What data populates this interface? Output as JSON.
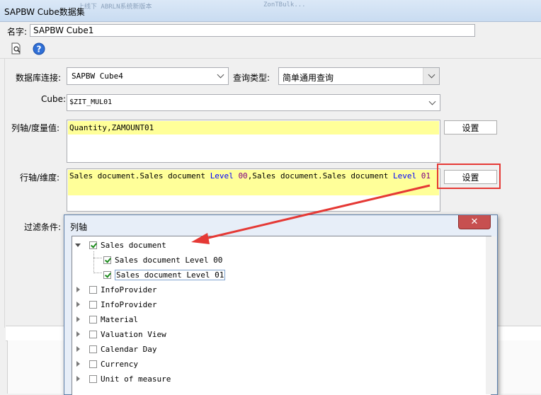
{
  "window": {
    "title": "SAPBW Cube数据集",
    "ghost_text_1": "上线下 ABRLN系统新版本",
    "ghost_text_2": "ZonTBulk..."
  },
  "form": {
    "name_label": "名字:",
    "name_value": "SAPBW Cube1",
    "db_label": "数据库连接:",
    "db_value": "SAPBW Cube4",
    "query_type_label": "查询类型:",
    "query_type_value": "简单通用查询",
    "cube_label": "Cube:",
    "cube_value": "$ZIT_MUL01",
    "measure_label": "列轴/度量值:",
    "measure_value": "Quantity,ZAMOUNT01",
    "measure_button": "设置",
    "dimension_label": "行轴/维度:",
    "dimension_value_p1": "Sales document.Sales document ",
    "dimension_value_kw1": "Level",
    "dimension_value_num1": "00",
    "dimension_value_p2": ",Sales document.Sales document ",
    "dimension_value_kw2": "Level",
    "dimension_value_num2": "01",
    "dimension_button": "设置",
    "filter_label": "过滤条件:"
  },
  "dialog": {
    "title": "列轴",
    "close_symbol": "✕",
    "tree": [
      {
        "label": "Sales document",
        "checked": true,
        "expanded": true
      },
      {
        "label": "Sales document Level 00",
        "checked": true,
        "child": true
      },
      {
        "label": "Sales document Level 01",
        "checked": true,
        "child": true,
        "selected": true
      },
      {
        "label": "InfoProvider",
        "checked": false
      },
      {
        "label": "InfoProvider",
        "checked": false
      },
      {
        "label": "Material",
        "checked": false
      },
      {
        "label": "Valuation View",
        "checked": false
      },
      {
        "label": "Calendar Day",
        "checked": false
      },
      {
        "label": "Currency",
        "checked": false
      },
      {
        "label": "Unit of measure",
        "checked": false
      }
    ]
  },
  "colors": {
    "highlight": "#ffff99",
    "annotation_red": "#e53935",
    "keyword_blue": "#0000ff",
    "number_purple": "#800080"
  },
  "icons": [
    "preview-icon",
    "help-icon",
    "arrow-annotation"
  ]
}
